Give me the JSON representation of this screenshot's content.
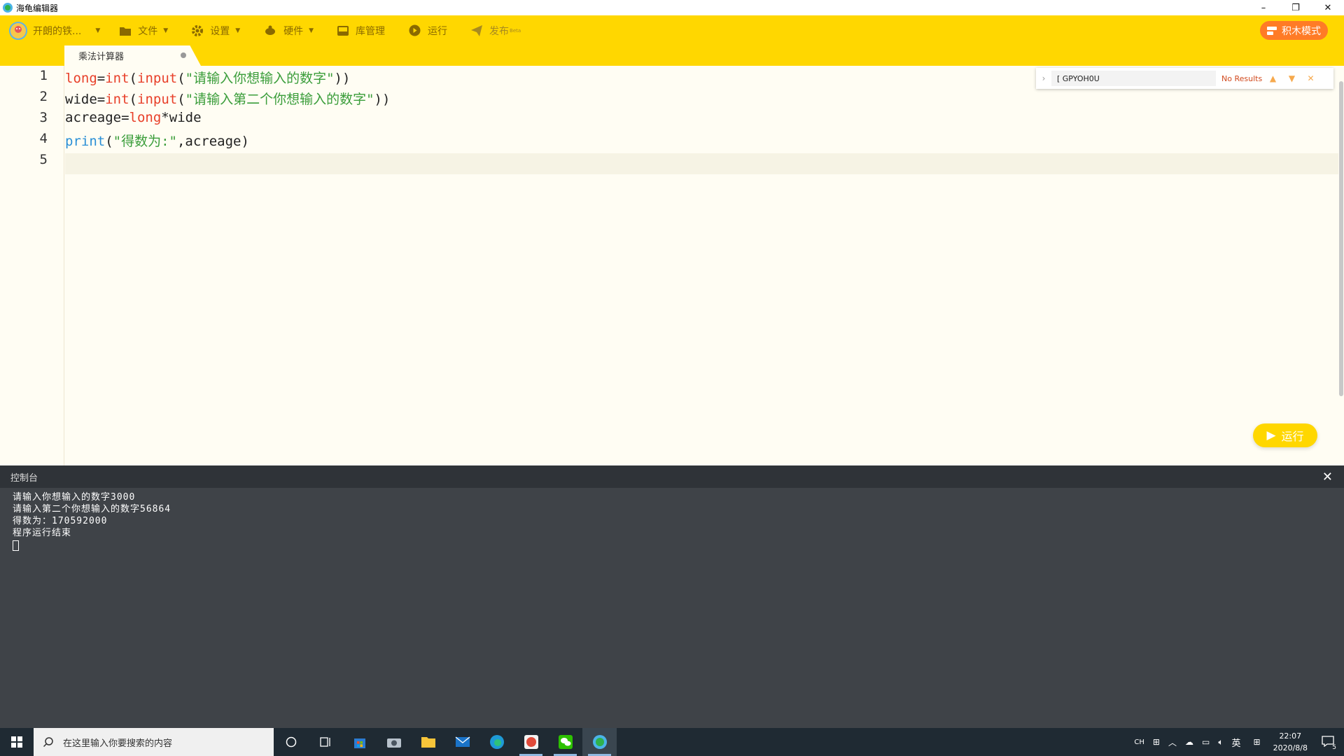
{
  "window": {
    "title": "海龟编辑器",
    "min": "–",
    "restore": "❐",
    "close": "✕"
  },
  "toolbar": {
    "user_label": "开朗的铁...",
    "file_label": "文件",
    "settings_label": "设置",
    "hardware_label": "硬件",
    "library_label": "库管理",
    "run_label": "运行",
    "publish_label": "发布",
    "publish_badge": "Beta",
    "block_mode_label": "积木模式"
  },
  "tab": {
    "label": "乘法计算器"
  },
  "editor": {
    "line_numbers": [
      "1",
      "2",
      "3",
      "4",
      "5"
    ],
    "lines": [
      [
        {
          "t": "long",
          "c": "kw"
        },
        {
          "t": "=",
          "c": "op"
        },
        {
          "t": "int",
          "c": "kw"
        },
        {
          "t": "(",
          "c": "op"
        },
        {
          "t": "input",
          "c": "kw"
        },
        {
          "t": "(",
          "c": "op"
        },
        {
          "t": "\"请输入你想输入的数字\"",
          "c": "str"
        },
        {
          "t": "))",
          "c": "op"
        }
      ],
      [
        {
          "t": "wide",
          "c": "op"
        },
        {
          "t": "=",
          "c": "op"
        },
        {
          "t": "int",
          "c": "kw"
        },
        {
          "t": "(",
          "c": "op"
        },
        {
          "t": "input",
          "c": "kw"
        },
        {
          "t": "(",
          "c": "op"
        },
        {
          "t": "\"请输入第二个你想输入的数字\"",
          "c": "str"
        },
        {
          "t": "))",
          "c": "op"
        }
      ],
      [
        {
          "t": "acreage",
          "c": "op"
        },
        {
          "t": "=",
          "c": "op"
        },
        {
          "t": "long",
          "c": "kw"
        },
        {
          "t": "*",
          "c": "op"
        },
        {
          "t": "wide",
          "c": "op"
        }
      ],
      [
        {
          "t": "print",
          "c": "fn"
        },
        {
          "t": "(",
          "c": "op"
        },
        {
          "t": "\"得数为:\"",
          "c": "str"
        },
        {
          "t": ",acreage)",
          "c": "op"
        }
      ],
      []
    ]
  },
  "find": {
    "query": "[ GPYOH0U",
    "status": "No Results"
  },
  "run_button": {
    "label": "运行"
  },
  "console": {
    "title": "控制台",
    "lines": [
      "请输入你想输入的数字3000",
      "请输入第二个你想输入的数字56864",
      "得数为：170592000",
      "程序运行结束"
    ]
  },
  "taskbar": {
    "search_placeholder": "在这里输入你要搜索的内容",
    "tray_lang": "CH",
    "tray_ime": "英",
    "time": "22:07",
    "date": "2020/8/8",
    "notif_count": "5"
  },
  "colors": {
    "toolbar": "#ffd700",
    "editor_bg": "#fffdf3",
    "console_bg": "#3f4348",
    "block_mode": "#ff7b26"
  }
}
